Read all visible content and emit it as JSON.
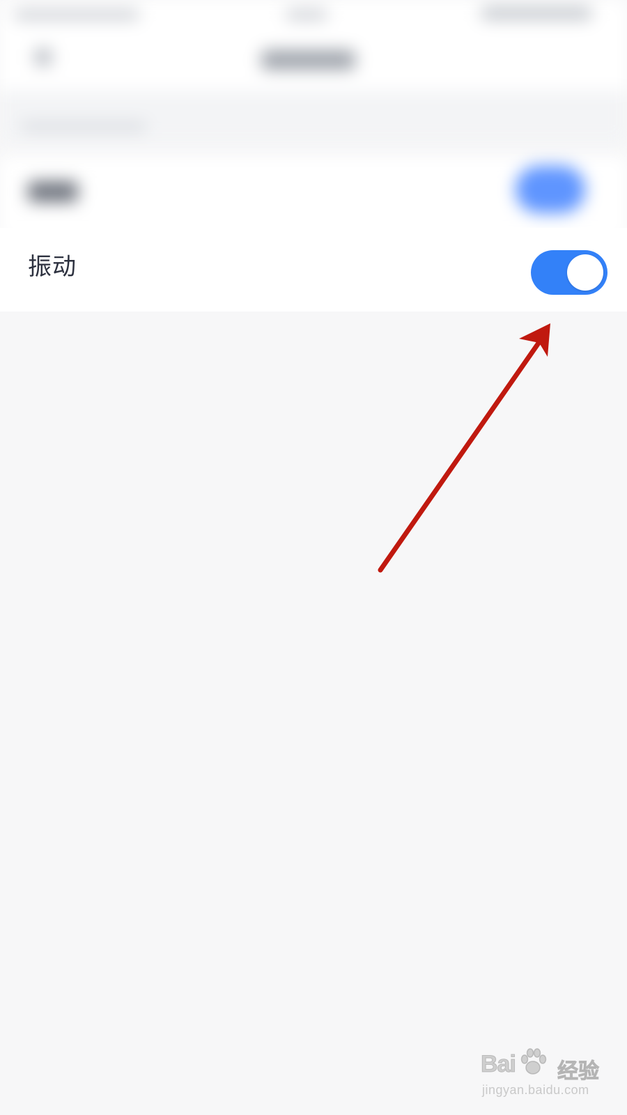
{
  "settings": {
    "vibration": {
      "label": "振动",
      "enabled": true
    }
  },
  "colors": {
    "background": "#f7f7f8",
    "row_background": "#ffffff",
    "label_text": "#2e3240",
    "toggle_on": "#3381f8",
    "annotation_arrow": "#c0190f"
  },
  "watermark": {
    "brand": "Bai",
    "suffix": "经验",
    "url": "jingyan.baidu.com"
  }
}
